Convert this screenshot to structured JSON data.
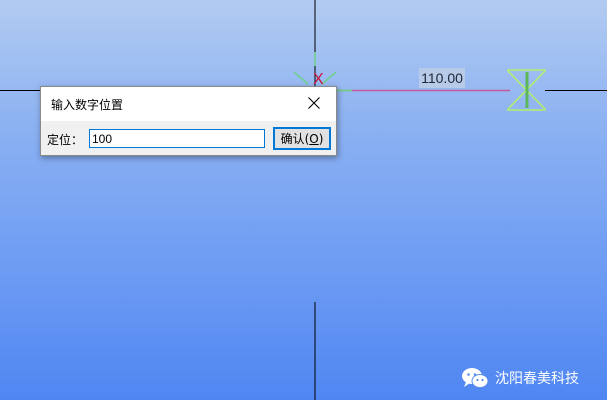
{
  "viewport": {
    "background_top": "#b2cbf1",
    "background_bottom": "#4f86f2",
    "axis_color": "#000000",
    "dimension_value": "110.00",
    "dimension_line_color": "#c85a9a",
    "marker_color": "#b4f06a",
    "axis_marker_color": "#6ed08c",
    "origin_marker": "X",
    "origin_marker_color": "#c8143c"
  },
  "dialog": {
    "title": "输入数字位置",
    "close_icon": "close-icon",
    "field_label": "定位：",
    "input_value": "100",
    "ok_label": "确认(",
    "ok_accel": "O",
    "ok_label_end": ")"
  },
  "watermark": {
    "text": "沈阳春美科技",
    "icon": "wechat-icon"
  }
}
